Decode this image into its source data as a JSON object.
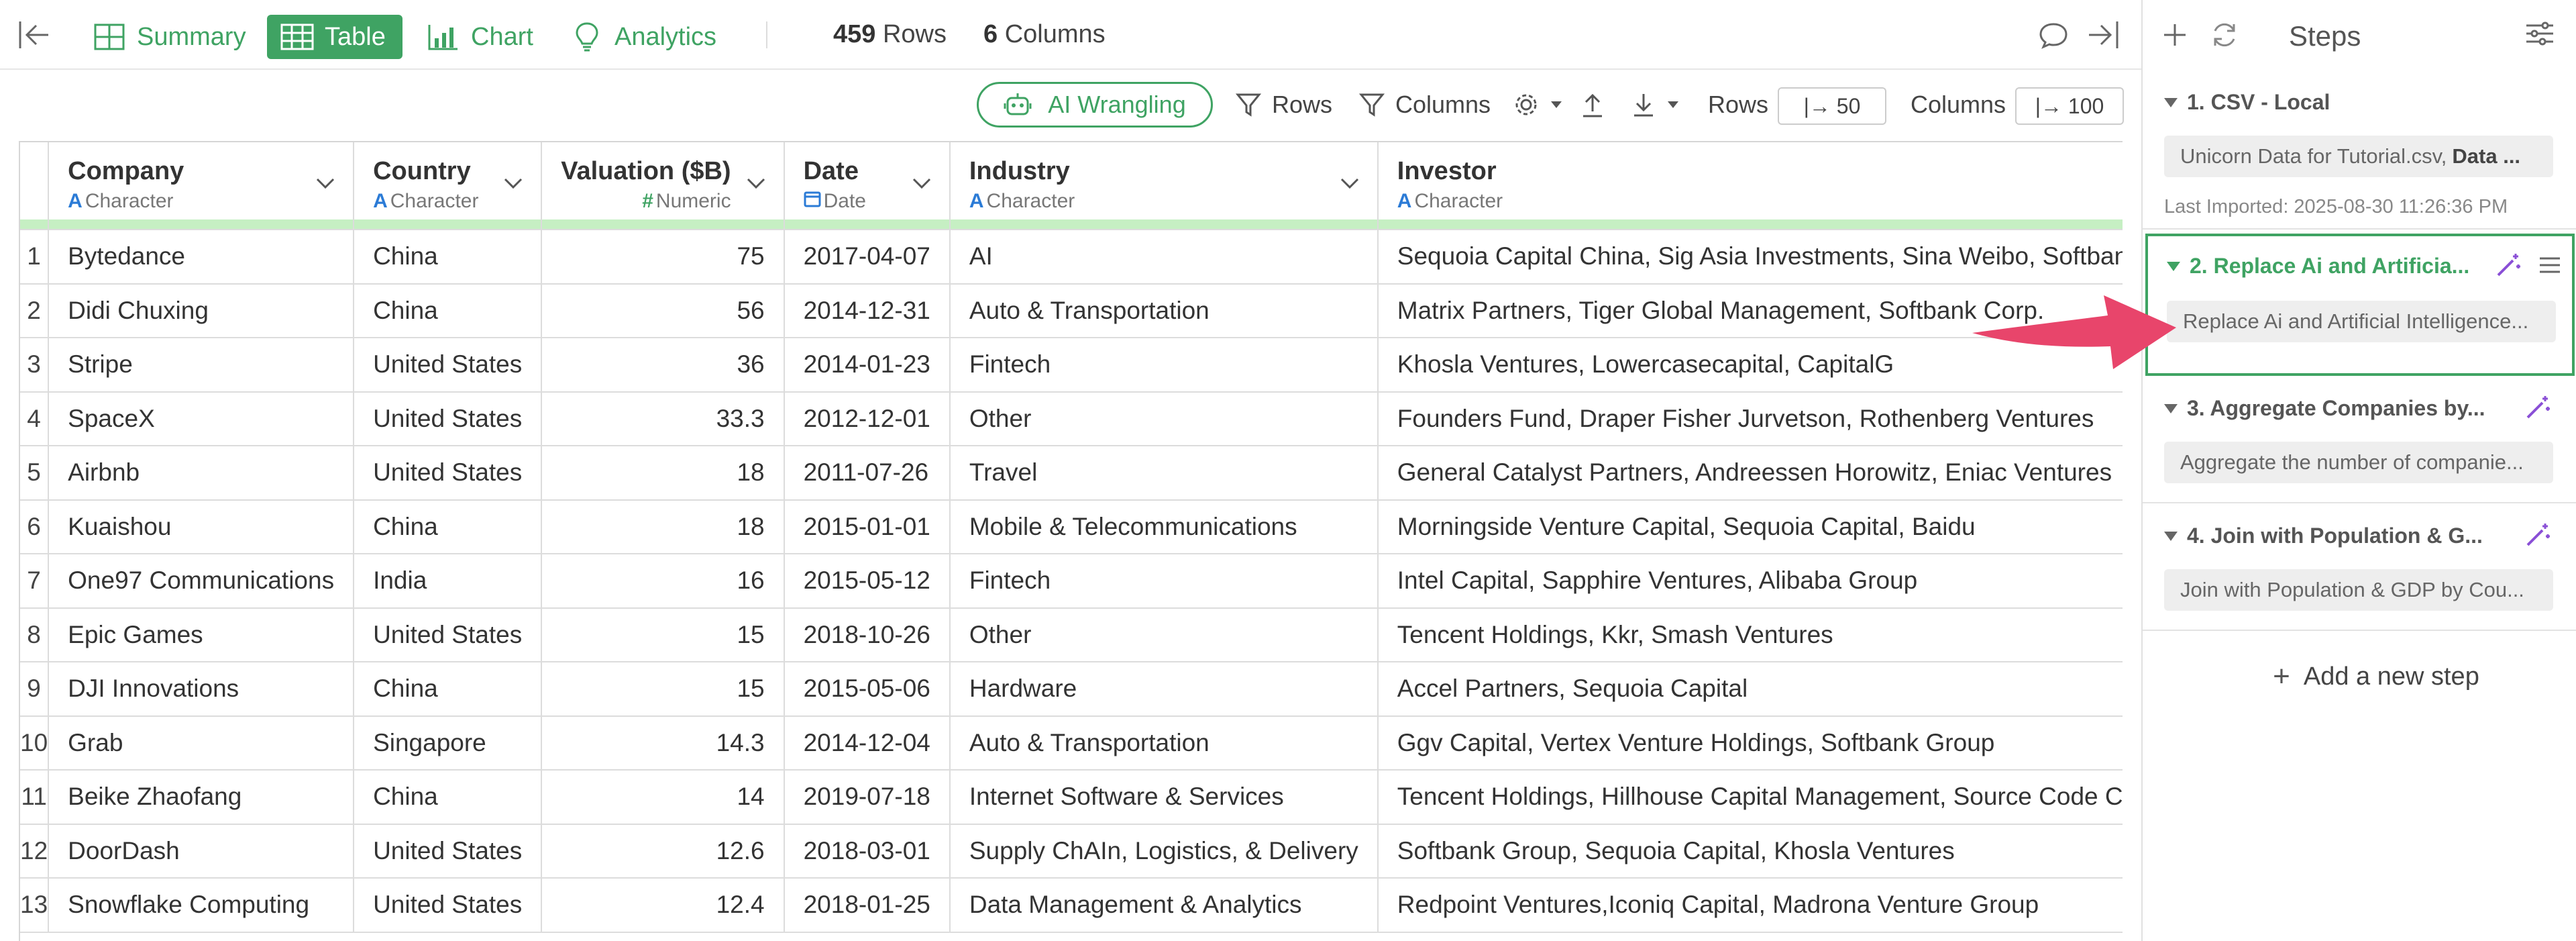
{
  "view_tabs": {
    "summary": "Summary",
    "table": "Table",
    "chart": "Chart",
    "analytics": "Analytics"
  },
  "meta": {
    "rows_count": "459",
    "rows_label": "Rows",
    "cols_count": "6",
    "cols_label": "Columns"
  },
  "toolbar": {
    "ai_wrangling": "AI Wrangling",
    "rows_filter": "Rows",
    "columns_filter": "Columns",
    "rows_label": "Rows",
    "rows_value": "|→ 50",
    "columns_label": "Columns",
    "columns_value": "|→ 100"
  },
  "columns": [
    {
      "name": "Company",
      "type": "Character",
      "type_icon": "A"
    },
    {
      "name": "Country",
      "type": "Character",
      "type_icon": "A"
    },
    {
      "name": "Valuation ($B)",
      "type": "Numeric",
      "type_icon": "#"
    },
    {
      "name": "Date",
      "type": "Date",
      "type_icon": "calendar-icon"
    },
    {
      "name": "Industry",
      "type": "Character",
      "type_icon": "A"
    },
    {
      "name": "Investor",
      "type": "Character",
      "type_icon": "A"
    }
  ],
  "rows": [
    [
      "1",
      "Bytedance",
      "China",
      "75",
      "2017-04-07",
      "AI",
      "Sequoia Capital China, Sig Asia Investments, Sina Weibo, Softbank Group"
    ],
    [
      "2",
      "Didi Chuxing",
      "China",
      "56",
      "2014-12-31",
      "Auto & Transportation",
      "Matrix Partners, Tiger Global Management, Softbank Corp."
    ],
    [
      "3",
      "Stripe",
      "United States",
      "36",
      "2014-01-23",
      "Fintech",
      "Khosla Ventures, Lowercasecapital, CapitalG"
    ],
    [
      "4",
      "SpaceX",
      "United States",
      "33.3",
      "2012-12-01",
      "Other",
      "Founders Fund, Draper Fisher Jurvetson, Rothenberg Ventures"
    ],
    [
      "5",
      "Airbnb",
      "United States",
      "18",
      "2011-07-26",
      "Travel",
      "General Catalyst Partners, Andreessen Horowitz, Eniac Ventures"
    ],
    [
      "6",
      "Kuaishou",
      "China",
      "18",
      "2015-01-01",
      "Mobile & Telecommunications",
      "Morningside Venture Capital, Sequoia Capital, Baidu"
    ],
    [
      "7",
      "One97 Communications",
      "India",
      "16",
      "2015-05-12",
      "Fintech",
      "Intel Capital, Sapphire Ventures, Alibaba Group"
    ],
    [
      "8",
      "Epic Games",
      "United States",
      "15",
      "2018-10-26",
      "Other",
      "Tencent Holdings, Kkr, Smash Ventures"
    ],
    [
      "9",
      "DJI Innovations",
      "China",
      "15",
      "2015-05-06",
      "Hardware",
      "Accel Partners, Sequoia Capital"
    ],
    [
      "10",
      "Grab",
      "Singapore",
      "14.3",
      "2014-12-04",
      "Auto & Transportation",
      "Ggv Capital, Vertex Venture Holdings, Softbank Group"
    ],
    [
      "11",
      "Beike Zhaofang",
      "China",
      "14",
      "2019-07-18",
      "Internet Software & Services",
      "Tencent Holdings, Hillhouse Capital Management, Source Code Capital"
    ],
    [
      "12",
      "DoorDash",
      "United States",
      "12.6",
      "2018-03-01",
      "Supply ChAIn, Logistics, & Delivery",
      "Softbank Group, Sequoia Capital, Khosla Ventures"
    ],
    [
      "13",
      "Snowflake Computing",
      "United States",
      "12.4",
      "2018-01-25",
      "Data Management & Analytics",
      "Redpoint Ventures,Iconiq Capital, Madrona Venture Group"
    ]
  ],
  "steps": {
    "title": "Steps",
    "items": [
      {
        "title": "1. CSV - Local",
        "desc": "Unicorn Data for Tutorial.csv,",
        "desc_bold": "Data ...",
        "sub": "Last Imported: 2025-08-30 11:26:36 PM"
      },
      {
        "title": "2. Replace Ai and Artificia...",
        "desc": "Replace Ai and Artificial Intelligence..."
      },
      {
        "title": "3. Aggregate Companies by...",
        "desc": "Aggregate the number of companie..."
      },
      {
        "title": "4. Join with Population & G...",
        "desc": "Join with Population & GDP by Cou..."
      }
    ],
    "add_step": "Add a new step"
  },
  "colors": {
    "accent": "#3fa363",
    "type_icon": "#2b7bd6",
    "arrow": "#e8456b",
    "wand": "#8a4fd6"
  }
}
